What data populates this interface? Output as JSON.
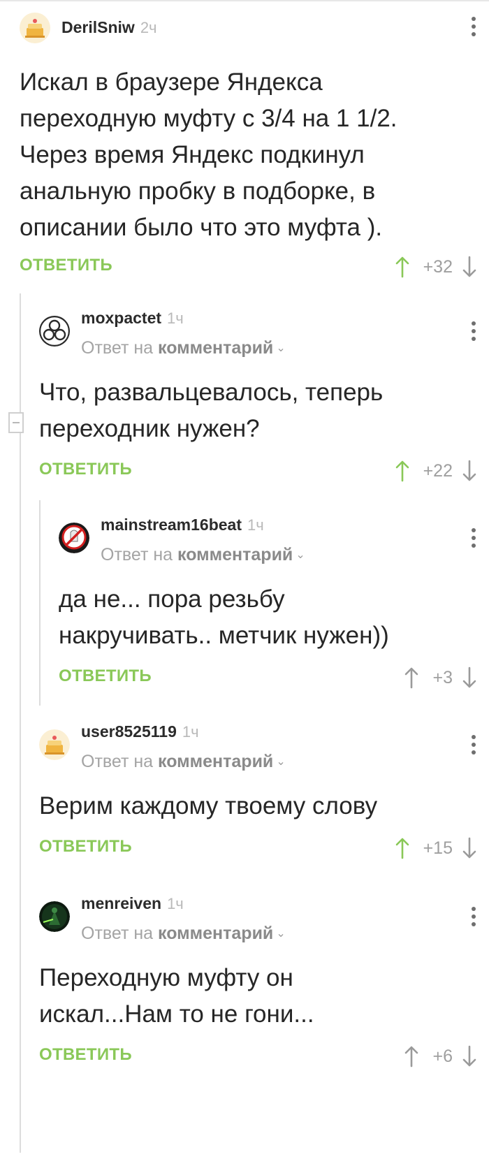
{
  "reply_to_prefix": "Ответ на",
  "reply_to_target": "комментарий",
  "reply_label": "ОТВЕТИТЬ",
  "colors": {
    "accent_green": "#8ac858",
    "upvote_active": "#8ac858",
    "neutral_arrow": "#9a9a9a",
    "thread_line": "#dcdcdc"
  },
  "comments": [
    {
      "username": "DerilSniw",
      "time": "2ч",
      "avatar_icon": "cake-avatar-icon",
      "text_lines": [
        "Искал в браузере Яндекса",
        "переходную муфту с 3/4 на 1 1/2.",
        "Через время Яндекс подкинул",
        "анальную пробку в подборке, в",
        "описании было что это муфта )."
      ],
      "score": "+32",
      "upvoted": true
    },
    {
      "username": "moxpactet",
      "time": "1ч",
      "avatar_icon": "triskelion-avatar-icon",
      "text_lines": [
        "Что, развальцевалось, теперь",
        "переходник нужен?"
      ],
      "score": "+22",
      "upvoted": true
    },
    {
      "username": "mainstream16beat",
      "time": "1ч",
      "avatar_icon": "ghostbusters-avatar-icon",
      "text_lines": [
        "да не... пора резьбу",
        "накручивать.. метчик нужен))"
      ],
      "score": "+3",
      "upvoted": false
    },
    {
      "username": "user8525119",
      "time": "1ч",
      "avatar_icon": "cake-avatar-icon",
      "text_lines": [
        "Верим каждому твоему слову"
      ],
      "score": "+15",
      "upvoted": true
    },
    {
      "username": "menreiven",
      "time": "1ч",
      "avatar_icon": "green-figure-avatar-icon",
      "text_lines": [
        "Переходную муфту он",
        "искал...Нам то не гони..."
      ],
      "score": "+6",
      "upvoted": false
    }
  ]
}
